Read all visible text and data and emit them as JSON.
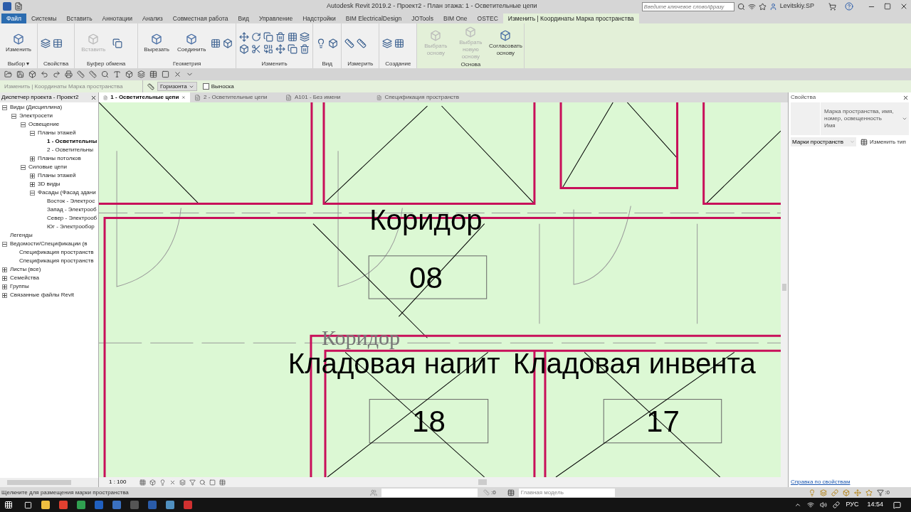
{
  "title_bar": {
    "title": "Autodesk Revit 2019.2 - Проект2 - План этажа: 1 - Осветительные цепи",
    "search_placeholder": "Введите ключевое слово/фразу",
    "user": "Levitskiy.SP"
  },
  "ribbon_tabs": [
    {
      "label": "Файл",
      "kind": "file",
      "selected": false
    },
    {
      "label": "Системы",
      "kind": "tab",
      "selected": false
    },
    {
      "label": "Вставить",
      "kind": "tab",
      "selected": false
    },
    {
      "label": "Аннотации",
      "kind": "tab",
      "selected": false
    },
    {
      "label": "Анализ",
      "kind": "tab",
      "selected": false
    },
    {
      "label": "Совместная работа",
      "kind": "tab",
      "selected": false
    },
    {
      "label": "Вид",
      "kind": "tab",
      "selected": false
    },
    {
      "label": "Управление",
      "kind": "tab",
      "selected": false
    },
    {
      "label": "Надстройки",
      "kind": "tab",
      "selected": false
    },
    {
      "label": "BIM ElectricalDesign",
      "kind": "tab",
      "selected": false
    },
    {
      "label": "JOTools",
      "kind": "tab",
      "selected": false
    },
    {
      "label": "BIM One",
      "kind": "tab",
      "selected": false
    },
    {
      "label": "OSTEC",
      "kind": "tab",
      "selected": false
    },
    {
      "label": "Изменить | Координаты Марка пространства",
      "kind": "contextual",
      "selected": true
    }
  ],
  "ribbon_panels": [
    {
      "label": "Выбор",
      "menu": "▾",
      "contextual": false,
      "buttons": [
        {
          "label": "Изменить",
          "disabled": false
        }
      ]
    },
    {
      "label": "Свойства",
      "contextual": false
    },
    {
      "label": "Буфер обмена",
      "contextual": false,
      "buttons": [
        {
          "label": "Вставить",
          "disabled": true
        }
      ]
    },
    {
      "label": "Геометрия",
      "contextual": false,
      "buttons": [
        {
          "label": "Вырезать",
          "disabled": false
        },
        {
          "label": "Соединить",
          "disabled": false
        }
      ]
    },
    {
      "label": "Изменить",
      "contextual": false
    },
    {
      "label": "Вид",
      "contextual": false
    },
    {
      "label": "Измерить",
      "contextual": false
    },
    {
      "label": "Создание",
      "contextual": false
    },
    {
      "label": "Основа",
      "contextual": true,
      "buttons": [
        {
          "label": "Выбрать основу",
          "disabled": true
        },
        {
          "label": "Выбрать новую основу",
          "disabled": true
        },
        {
          "label": "Согласовать основу",
          "disabled": false
        }
      ]
    }
  ],
  "options_bar": {
    "context": "Изменить | Координаты Марка пространства",
    "orientation": "Горизонта",
    "leader": {
      "label": "Выноска",
      "checked": false
    }
  },
  "project_browser": {
    "title": "Диспетчер проекта - Проект2",
    "tree": [
      {
        "label": "Виды (Дисциплина)",
        "expanded": true,
        "selected": false,
        "children": [
          {
            "label": "Электросети",
            "expanded": true,
            "selected": false,
            "children": [
              {
                "label": "Освещение",
                "expanded": true,
                "selected": false,
                "children": [
                  {
                    "label": "Планы этажей",
                    "expanded": true,
                    "selected": false,
                    "children": [
                      {
                        "label": "1 - Осветительны",
                        "selected": true
                      },
                      {
                        "label": "2 - Осветительны",
                        "selected": false
                      }
                    ]
                  },
                  {
                    "label": "Планы потолков",
                    "expanded": false,
                    "selected": false
                  }
                ]
              },
              {
                "label": "Силовые цепи",
                "expanded": true,
                "selected": false,
                "children": [
                  {
                    "label": "Планы этажей",
                    "expanded": false,
                    "selected": false
                  },
                  {
                    "label": "3D виды",
                    "expanded": false,
                    "selected": false
                  },
                  {
                    "label": "Фасады (Фасад здани",
                    "expanded": true,
                    "selected": false,
                    "children": [
                      {
                        "label": "Восток - Электрос",
                        "selected": false
                      },
                      {
                        "label": "Запад - Электрооб",
                        "selected": false
                      },
                      {
                        "label": "Север - Электрооб",
                        "selected": false
                      },
                      {
                        "label": "Юг - Электрообор",
                        "selected": false
                      }
                    ]
                  }
                ]
              }
            ]
          }
        ]
      },
      {
        "label": "Легенды",
        "selected": false
      },
      {
        "label": "Ведомости/Спецификации (в",
        "expanded": true,
        "selected": false,
        "children": [
          {
            "label": "Спецификация пространств",
            "selected": false
          },
          {
            "label": "Спецификация пространств",
            "selected": false
          }
        ]
      },
      {
        "label": "Листы (все)",
        "expanded": false,
        "selected": false
      },
      {
        "label": "Семейства",
        "expanded": false,
        "selected": false
      },
      {
        "label": "Группы",
        "expanded": false,
        "selected": false
      },
      {
        "label": "Связанные файлы Revit",
        "expanded": false,
        "selected": false
      }
    ]
  },
  "view_tabs": [
    {
      "label": "1 - Осветительные цепи",
      "selected": true
    },
    {
      "label": "2 - Осветительные цепи",
      "selected": false
    },
    {
      "label": "A101 - Без имени",
      "selected": false
    },
    {
      "label": "Спецификация пространств",
      "selected": false
    }
  ],
  "plan": {
    "corridor_name": "Коридор",
    "corridor_number": "08",
    "placing_tag": "Коридор",
    "lower_names": [
      "Кладовая напит",
      "Кладовая инвента"
    ],
    "lower_numbers": [
      "18",
      "17"
    ]
  },
  "view_bar": {
    "scale": "1 : 100"
  },
  "properties": {
    "title": "Свойства",
    "type_name": "Марка пространства, имя, номер, освещенность",
    "type_sub": "Имя",
    "filter": "Марки пространств",
    "edit_type": "Изменить тип",
    "help_link": "Справка по свойствам"
  },
  "status_bar": {
    "message": "Щелкните для размещения марки пространства",
    "count": ":0",
    "model": "Главная модель",
    "filter_count": ":0"
  },
  "taskbar": {
    "language": "РУС",
    "time": "14:54"
  }
}
